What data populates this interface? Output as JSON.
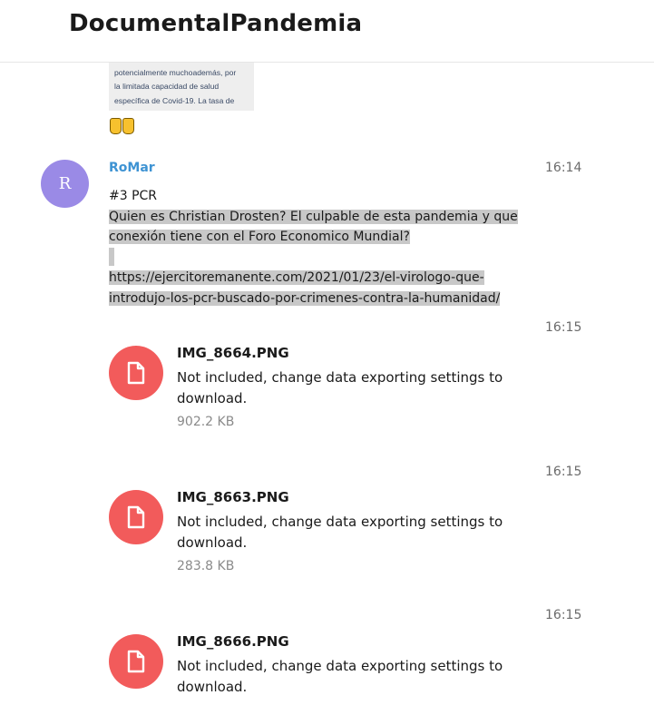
{
  "header": {
    "title": "DocumentalPandemia"
  },
  "previous_message": {
    "image_text": "En país se impactado más el reale y\npotencialmente muchoademás, por\nla limitada capacidad de salud\nespecífica de Covid-19. La tasa de",
    "reaction": "👍👍"
  },
  "message": {
    "avatar_letter": "R",
    "author": "RoMar",
    "time": "16:14",
    "lines": [
      "#3 PCR",
      "Quien es Christian Drosten? El culpable de esta pandemia y que",
      "conexión tiene con el Foro Economico Mundial?",
      "",
      "https://ejercitoremanente.com/2021/01/23/el-virologo-que-",
      "introdujo-los-pcr-buscado-por-crimenes-contra-la-humanidad/"
    ]
  },
  "files": [
    {
      "time": "16:15",
      "name": "IMG_8664.PNG",
      "status": "Not included, change data exporting settings to download.",
      "size": "902.2 KB"
    },
    {
      "time": "16:15",
      "name": "IMG_8663.PNG",
      "status": "Not included, change data exporting settings to download.",
      "size": "283.8 KB"
    },
    {
      "time": "16:15",
      "name": "IMG_8666.PNG",
      "status": "Not included, change data exporting settings to download.",
      "size": ""
    }
  ],
  "colors": {
    "accent_author": "#3e93d3",
    "avatar_bg": "#9a8ae6",
    "file_icon_bg": "#f25b5b",
    "selection_bg": "#c8c8c8"
  },
  "icons": {
    "file": "file-icon",
    "reaction": "thumbs-up-icon"
  }
}
